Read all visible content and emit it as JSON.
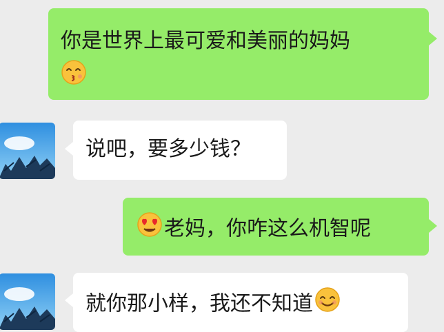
{
  "messages": [
    {
      "direction": "outgoing",
      "text_line1": "你是世界上最可爱和美丽的妈妈",
      "emoji": "kissing-face-icon"
    },
    {
      "direction": "incoming",
      "text": "说吧，要多少钱？"
    },
    {
      "direction": "outgoing",
      "emoji": "heart-eyes-face-icon",
      "text": "老妈，你咋这么机智呢"
    },
    {
      "direction": "incoming",
      "text": "就你那小样，我还不知道",
      "emoji": "smiling-face-icon"
    }
  ],
  "colors": {
    "background": "#ececec",
    "outgoing_bubble": "#95ec69",
    "incoming_bubble": "#ffffff",
    "text": "#1a1a1a"
  }
}
